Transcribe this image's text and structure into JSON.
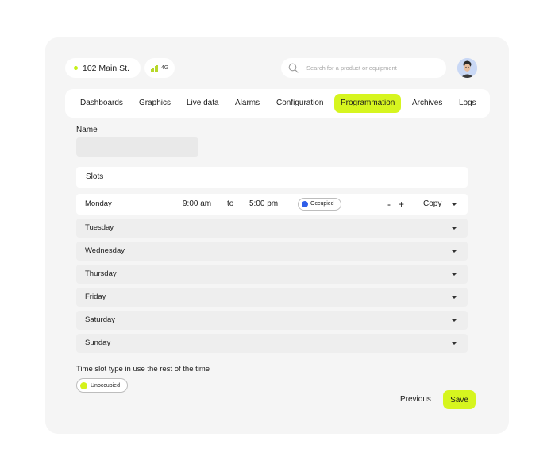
{
  "location": {
    "name": "102 Main St.",
    "status_color": "#c5f018"
  },
  "network": {
    "label": "4G",
    "icon": "signal-bars-icon"
  },
  "search": {
    "placeholder": "Search for a product or equipment",
    "icon": "search-icon"
  },
  "avatar": {
    "icon": "user-avatar"
  },
  "nav": {
    "items": [
      {
        "label": "Dashboards"
      },
      {
        "label": "Graphics"
      },
      {
        "label": "Live data"
      },
      {
        "label": "Alarms"
      },
      {
        "label": "Configuration"
      },
      {
        "label": "Programmation",
        "active": true
      },
      {
        "label": "Archives"
      },
      {
        "label": "Logs"
      }
    ],
    "active_color": "#d6f51f"
  },
  "form": {
    "name_label": "Name",
    "name_value": "",
    "slots_title": "Slots",
    "days": [
      {
        "label": "Monday",
        "expanded": true,
        "start": "9:00 am",
        "to": "to",
        "end": "5:00 pm",
        "type": "Occupied",
        "type_color": "#2f5ee8",
        "minus": "-",
        "plus": "+",
        "copy": "Copy"
      },
      {
        "label": "Tuesday"
      },
      {
        "label": "Wednesday"
      },
      {
        "label": "Thursday"
      },
      {
        "label": "Friday"
      },
      {
        "label": "Saturday"
      },
      {
        "label": "Sunday"
      }
    ],
    "rest_label": "Time slot type in use the rest of the time",
    "rest_type": "Unoccupied",
    "rest_type_color": "#d4f21c"
  },
  "actions": {
    "previous": "Previous",
    "save": "Save",
    "save_color": "#d6f51f"
  }
}
